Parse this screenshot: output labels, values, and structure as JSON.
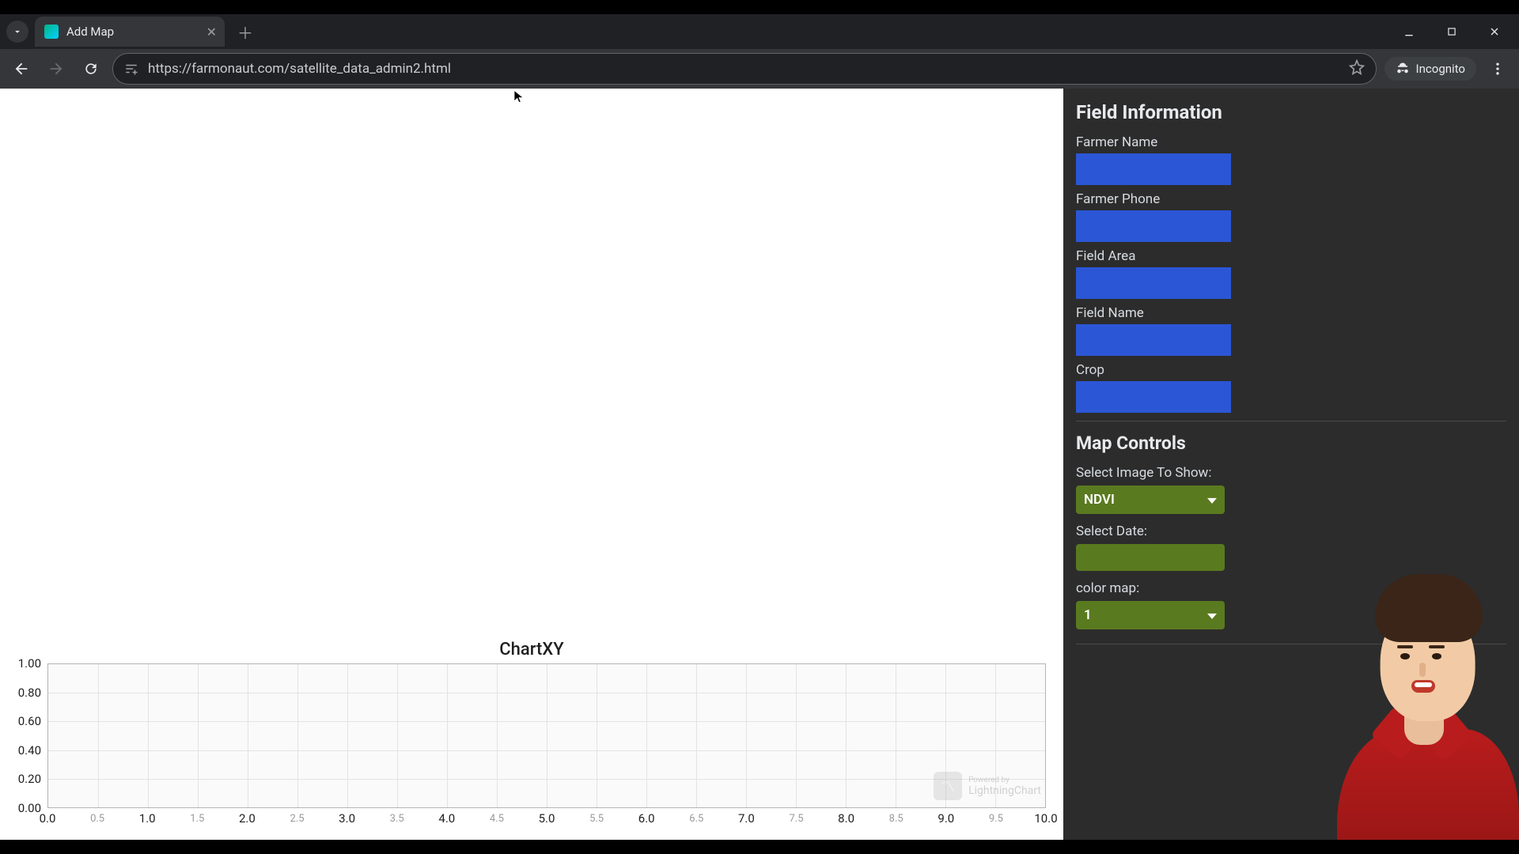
{
  "browser": {
    "tab_title": "Add Map",
    "url": "https://farmonaut.com/satellite_data_admin2.html",
    "incognito_label": "Incognito"
  },
  "sidebar": {
    "field_info_heading": "Field Information",
    "fields": {
      "farmer_name": {
        "label": "Farmer Name",
        "value": ""
      },
      "farmer_phone": {
        "label": "Farmer Phone",
        "value": ""
      },
      "field_area": {
        "label": "Field Area",
        "value": ""
      },
      "field_name": {
        "label": "Field Name",
        "value": ""
      },
      "crop": {
        "label": "Crop",
        "value": ""
      }
    },
    "map_controls_heading": "Map Controls",
    "controls": {
      "select_image_label": "Select Image To Show:",
      "select_image_value": "NDVI",
      "select_date_label": "Select Date:",
      "select_date_value": "",
      "color_map_label": "color map:",
      "color_map_value": "1"
    }
  },
  "chart_data": {
    "type": "line",
    "title": "ChartXY",
    "xlabel": "",
    "ylabel": "",
    "xlim": [
      0.0,
      10.0
    ],
    "ylim": [
      0.0,
      1.0
    ],
    "x_ticks_major": [
      "0.0",
      "1.0",
      "2.0",
      "3.0",
      "4.0",
      "5.0",
      "6.0",
      "7.0",
      "8.0",
      "9.0",
      "10.0"
    ],
    "x_ticks_minor": [
      "0.5",
      "1.5",
      "2.5",
      "3.5",
      "4.5",
      "5.5",
      "6.5",
      "7.5",
      "8.5",
      "9.5"
    ],
    "y_ticks": [
      "1.00",
      "0.80",
      "0.60",
      "0.40",
      "0.20",
      "0.00"
    ],
    "series": [],
    "watermark": {
      "powered_by": "Powered by",
      "name": "LightningChart"
    }
  }
}
